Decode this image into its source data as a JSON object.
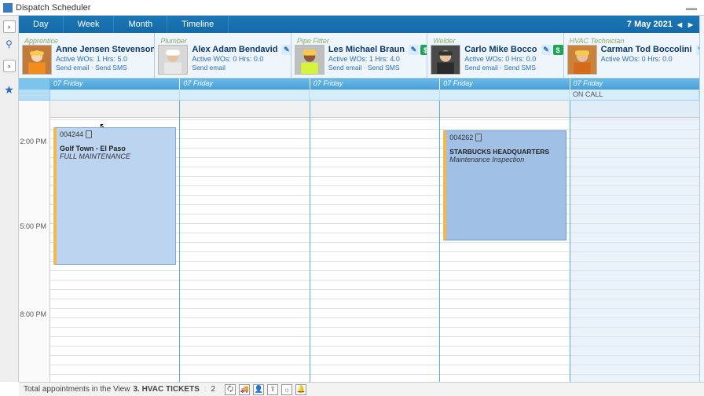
{
  "window": {
    "title": "Dispatch Scheduler"
  },
  "toolbar": {
    "views": [
      "Day",
      "Week",
      "Month",
      "Timeline"
    ],
    "date": "7 May 2021"
  },
  "technicians": [
    {
      "role": "Apprentice",
      "name": "Anne Jensen Stevenson",
      "stats": "Active WOs: 1  Hrs: 5.0",
      "actions": "Send email · Send SMS"
    },
    {
      "role": "Plumber",
      "name": "Alex Adam Bendavid",
      "stats": "Active WOs: 0  Hrs: 0.0",
      "actions": "Send email"
    },
    {
      "role": "Pipe Fitter",
      "name": "Les Michael Braun",
      "stats": "Active WOs: 1  Hrs: 4.0",
      "actions": "Send email · Send SMS"
    },
    {
      "role": "Welder",
      "name": "Carlo Mike Bocco",
      "stats": "Active WOs: 0  Hrs: 0.0",
      "actions": "Send email · Send SMS"
    },
    {
      "role": "HVAC Technician",
      "name": "Carman Tod Boccolini",
      "stats": "Active WOs: 0  Hrs: 0.0",
      "actions": ""
    }
  ],
  "day_label": "07 Friday",
  "oncall_label": "ON CALL",
  "time_labels": {
    "t1": "2:00 PM",
    "t2": "5:00 PM",
    "t3": "8:00 PM"
  },
  "appointments": {
    "a1": {
      "num": "004244",
      "location": "Golf Town - El Paso",
      "desc": "FULL MAINTENANCE"
    },
    "a2": {
      "num": "004262",
      "location": "STARBUCKS HEADQUARTERS",
      "desc": "Maintenance Inspection"
    }
  },
  "status": {
    "label": "Total appointments in the View",
    "section": "3. HVAC TICKETS",
    "count": "2"
  }
}
